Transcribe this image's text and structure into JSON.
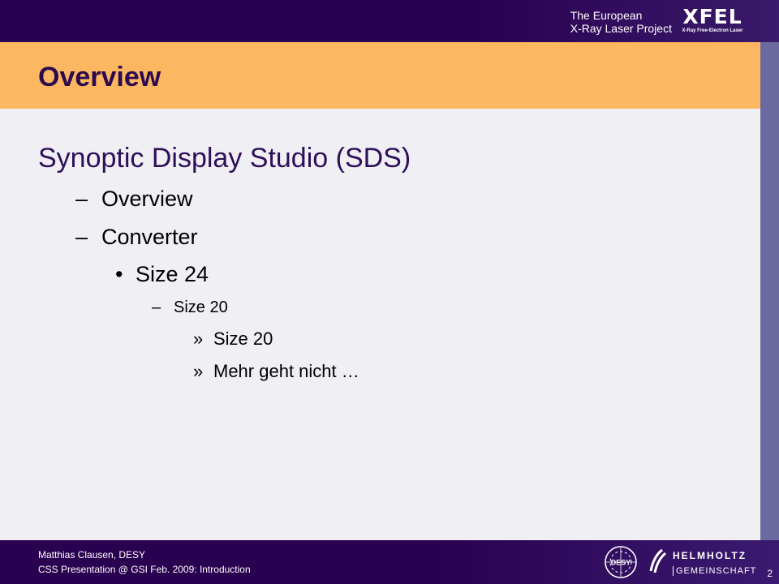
{
  "header": {
    "line1": "The European",
    "line2": "X-Ray Laser Project",
    "logo_text": "XFEL",
    "logo_sub": "X-Ray Free-Electron Laser"
  },
  "slide": {
    "title": "Overview",
    "bullets": {
      "l1": "Synoptic Display Studio (SDS)",
      "l2a_bullet": "–",
      "l2a": "Overview",
      "l2b_bullet": "–",
      "l2b": "Converter",
      "l3_bullet": "•",
      "l3": "Size 24",
      "l4_bullet": "–",
      "l4": "Size 20",
      "l5a_bullet": "»",
      "l5a": "Size 20",
      "l5b_bullet": "»",
      "l5b": "Mehr geht nicht …"
    }
  },
  "footer": {
    "author": "Matthias Clausen, DESY",
    "event": "CSS Presentation @ GSI Feb. 2009: Introduction",
    "page": "2",
    "desy_logo_text": "DESY",
    "helmholtz_line1": "HELMHOLTZ",
    "helmholtz_line2": "GEMEINSCHAFT"
  },
  "colors": {
    "header_bg": "#2a0050",
    "title_bar": "#fdb760",
    "title_text": "#2c0a4e",
    "content_bg": "#f0eff4",
    "side_band": "#6a6aa0"
  }
}
